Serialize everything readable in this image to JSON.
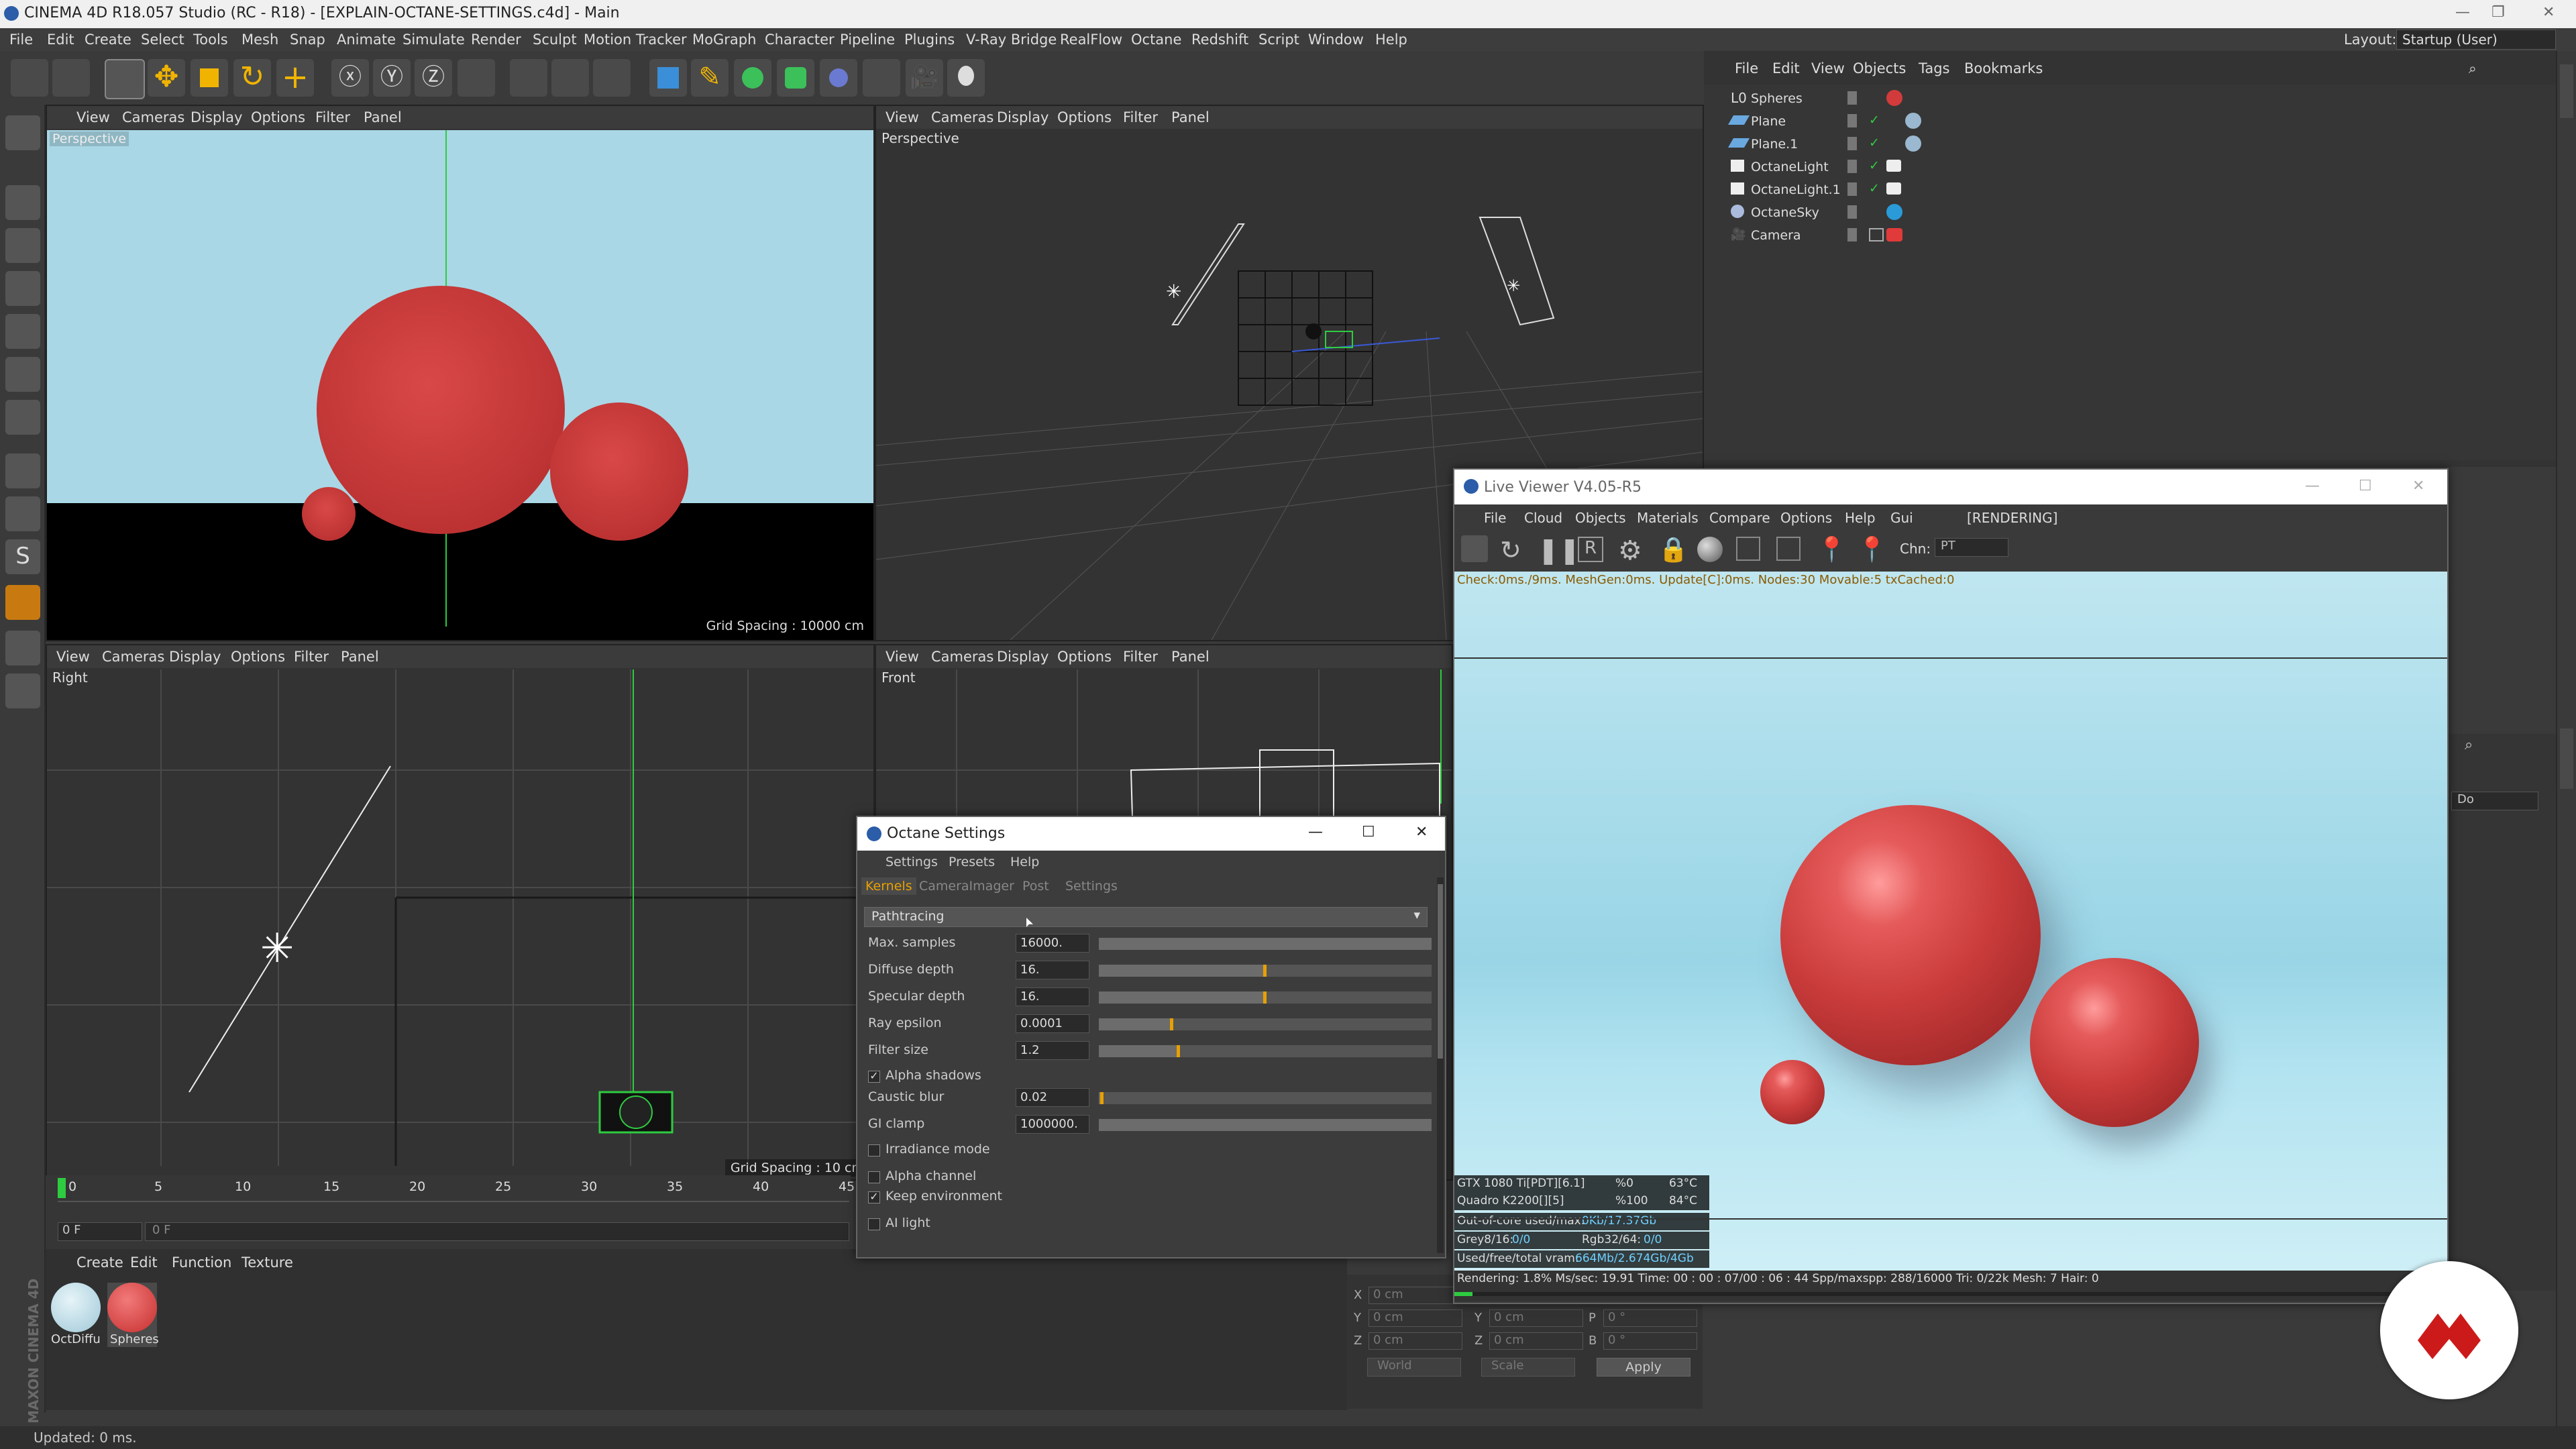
{
  "window": {
    "title": "CINEMA 4D R18.057 Studio (RC - R18) - [EXPLAIN-OCTANE-SETTINGS.c4d] - Main"
  },
  "menubar": {
    "items": [
      "File",
      "Edit",
      "Create",
      "Select",
      "Tools",
      "Mesh",
      "Snap",
      "Animate",
      "Simulate",
      "Render",
      "Sculpt",
      "Motion Tracker",
      "MoGraph",
      "Character",
      "Pipeline",
      "Plugins",
      "V-Ray Bridge",
      "RealFlow",
      "Octane",
      "Redshift",
      "Script",
      "Window",
      "Help"
    ],
    "layout_label": "Layout:",
    "layout_value": "Startup (User)"
  },
  "viewport_menu": [
    "View",
    "Cameras",
    "Display",
    "Options",
    "Filter",
    "Panel"
  ],
  "viewports": {
    "top_left": {
      "label": "Perspective",
      "grid_spacing": "Grid Spacing : 10000 cm"
    },
    "top_right": {
      "label": "Perspective"
    },
    "bottom_left": {
      "label": "Right",
      "grid_spacing": "Grid Spacing : 10 cm"
    },
    "bottom_right": {
      "label": "Front"
    }
  },
  "object_manager": {
    "menu": [
      "File",
      "Edit",
      "View",
      "Objects",
      "Tags",
      "Bookmarks"
    ],
    "objects": [
      {
        "name": "Spheres",
        "tag_color": "#d23b3b"
      },
      {
        "name": "Plane",
        "tag_color": "#9ab8cf"
      },
      {
        "name": "Plane.1",
        "tag_color": "#9ab8cf"
      },
      {
        "name": "OctaneLight",
        "tag_color": "#eeeeee"
      },
      {
        "name": "OctaneLight.1",
        "tag_color": "#eeeeee"
      },
      {
        "name": "OctaneSky",
        "tag_color": "#2a9ad8"
      },
      {
        "name": "Camera",
        "tag_color": "#e03a3a"
      }
    ]
  },
  "timeline": {
    "ticks": [
      "0",
      "5",
      "10",
      "15",
      "20",
      "25",
      "30",
      "35",
      "40",
      "45"
    ],
    "frame_field": "0 F",
    "frame_field2": "0 F"
  },
  "material_manager": {
    "menu": [
      "Create",
      "Edit",
      "Function",
      "Texture"
    ],
    "materials": [
      {
        "name": "OctDiffu",
        "color": "#9fc8d8"
      },
      {
        "name": "Spheres",
        "color": "#d23b3b"
      }
    ]
  },
  "coords": {
    "rows": [
      {
        "a": "X",
        "av": "0 cm",
        "b": "",
        "bv": "",
        "c": "",
        "cv": ""
      },
      {
        "a": "Y",
        "av": "0 cm",
        "b": "Y",
        "bv": "0 cm",
        "c": "P",
        "cv": "0 °"
      },
      {
        "a": "Z",
        "av": "0 cm",
        "b": "Z",
        "bv": "0 cm",
        "c": "B",
        "cv": "0 °"
      }
    ],
    "world": "World",
    "scale": "Scale",
    "apply": "Apply"
  },
  "status": {
    "text": "Updated: 0 ms."
  },
  "maxon": "MAXON CINEMA 4D",
  "octane_settings": {
    "title": "Octane Settings",
    "menu": [
      "Settings",
      "Presets",
      "Help"
    ],
    "tabs": [
      "Kernels",
      "CameraImager",
      "Post",
      "Settings"
    ],
    "kernel": "Pathtracing",
    "params": [
      {
        "label": "Max. samples",
        "value": "16000.",
        "level": 1.0
      },
      {
        "label": "Diffuse depth",
        "value": "16.",
        "level": 0.5
      },
      {
        "label": "Specular depth",
        "value": "16.",
        "level": 0.5
      },
      {
        "label": "Ray epsilon",
        "value": "0.0001",
        "level": 0.22
      },
      {
        "label": "Filter size",
        "value": "1.2",
        "level": 0.24
      }
    ],
    "alpha_shadows": {
      "label": "Alpha shadows",
      "checked": "✓"
    },
    "params2": [
      {
        "label": "Caustic blur",
        "value": "0.02",
        "level": 0.01
      },
      {
        "label": "GI clamp",
        "value": "1000000.",
        "level": 1.0
      }
    ],
    "checks": [
      {
        "label": "Irradiance mode",
        "checked": ""
      },
      {
        "label": "Alpha channel",
        "checked": ""
      },
      {
        "label": "Keep environment",
        "checked": "✓"
      },
      {
        "label": "AI light",
        "checked": ""
      }
    ]
  },
  "live_viewer": {
    "title": "Live Viewer V4.05-R5",
    "menu": [
      "File",
      "Cloud",
      "Objects",
      "Materials",
      "Compare",
      "Options",
      "Help",
      "Gui"
    ],
    "state": "[RENDERING]",
    "chn_label": "Chn:",
    "chn_value": "PT",
    "stats_line": "Check:0ms./9ms. MeshGen:0ms. Update[C]:0ms. Nodes:30 Movable:5 txCached:0",
    "gpu": [
      {
        "name": "GTX 1080 Ti[PDT][6.1]",
        "use": "%0",
        "temp": "63°C"
      },
      {
        "name": "Quadro K2200[][5]",
        "use": "%100",
        "temp": "84°C"
      }
    ],
    "mem": [
      {
        "label": "Out-of-core used/max:",
        "value": "0Kb/17.37Gb"
      },
      {
        "label": "Grey8/16: ",
        "value": "0/0",
        "label2": "Rgb32/64: ",
        "value2": "0/0"
      },
      {
        "label": "Used/free/total vram: ",
        "value": "664Mb/2.674Gb/4Gb"
      }
    ],
    "render_line": "Rendering: 1.8%   Ms/sec: 19.91   Time: 00 : 00 : 07/00 : 06 : 44   Spp/maxspp: 288/16000    Tri: 0/22k    Mesh: 7   Hair: 0",
    "progress": 0.018
  },
  "attributes": {
    "do_label": "Do"
  },
  "colors": {
    "accent": "#e8a000",
    "sphere": "#cf3b3b",
    "sky": "#a9d7e5",
    "logo": "#cc1a1a"
  }
}
